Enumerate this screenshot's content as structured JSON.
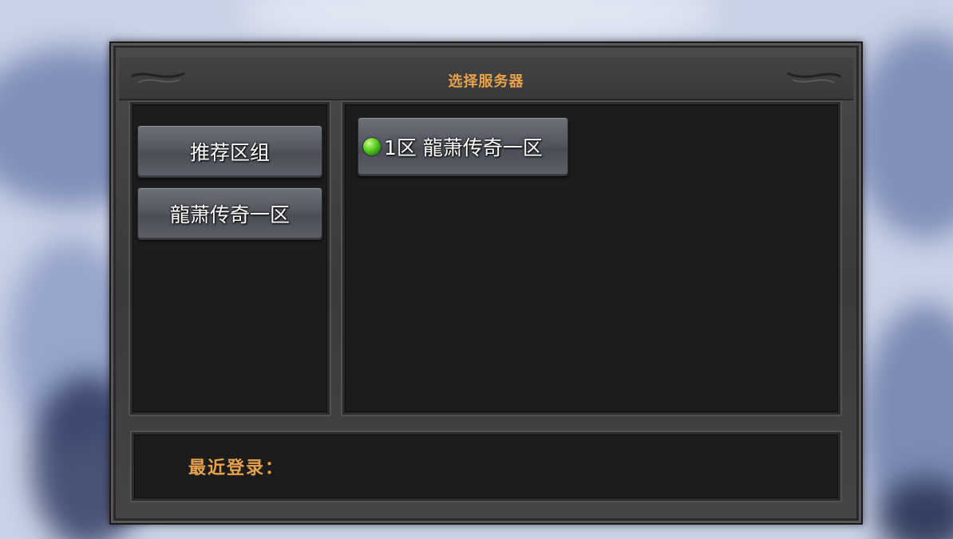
{
  "title": "选择服务器",
  "groups": [
    {
      "label": "推荐区组"
    },
    {
      "label": "龍萧传奇一区"
    }
  ],
  "servers": [
    {
      "label": "1区 龍萧传奇一区",
      "status": "online",
      "status_color": "#56c91e"
    }
  ],
  "recent_login": {
    "label": "最近登录："
  },
  "colors": {
    "accent": "#e6a24c",
    "panel": "#1c1c1c",
    "frame": "#3f3f3f"
  }
}
